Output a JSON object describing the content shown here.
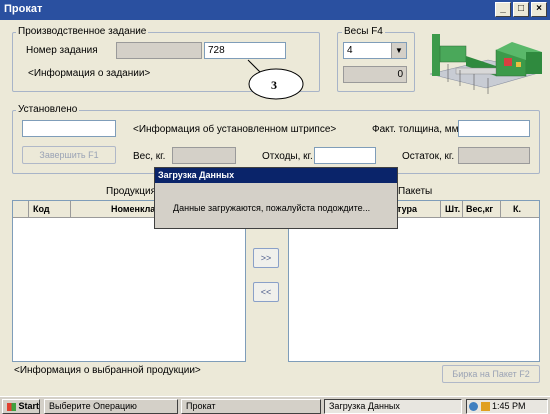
{
  "window": {
    "title": "Прокат",
    "controls": [
      "_",
      "□",
      "×"
    ]
  },
  "task_group": {
    "title": "Производственное задание",
    "order_label": "Номер задания",
    "order_value": "728",
    "info_text": "<Информация о задании>",
    "callout": "3"
  },
  "scales_group": {
    "title": "Весы  F4",
    "selected": "4",
    "weight": "0"
  },
  "installed_group": {
    "title": "Установлено",
    "strip_info": "<Информация об установленном штрипсе>",
    "thickness_label": "Факт. толщина, мм.",
    "finish_button": "Завершить      F1",
    "weight_label": "Вес, кг.",
    "waste_label": "Отходы, кг.",
    "remainder_label": "Остаток, кг."
  },
  "products": {
    "title": "Продукция",
    "columns": [
      "Код",
      "Номенклатура"
    ]
  },
  "packages": {
    "title": "Пакеты",
    "columns": [
      "тура",
      "Шт.",
      "Вес,кг",
      "К."
    ]
  },
  "move_buttons": {
    "right": ">>",
    "left": "<<"
  },
  "selected_info": "<Информация о выбранной продукции>",
  "tag_button": "Бирка на Пакет   F2",
  "modal": {
    "title": "Загрузка Данных",
    "message": "Данные загружаются, пожалуйста подождите..."
  },
  "taskbar": {
    "start": "Start",
    "items": [
      "Выберите Операцию",
      "Прокат",
      "Загрузка Данных"
    ],
    "time": "1:45 PM"
  }
}
